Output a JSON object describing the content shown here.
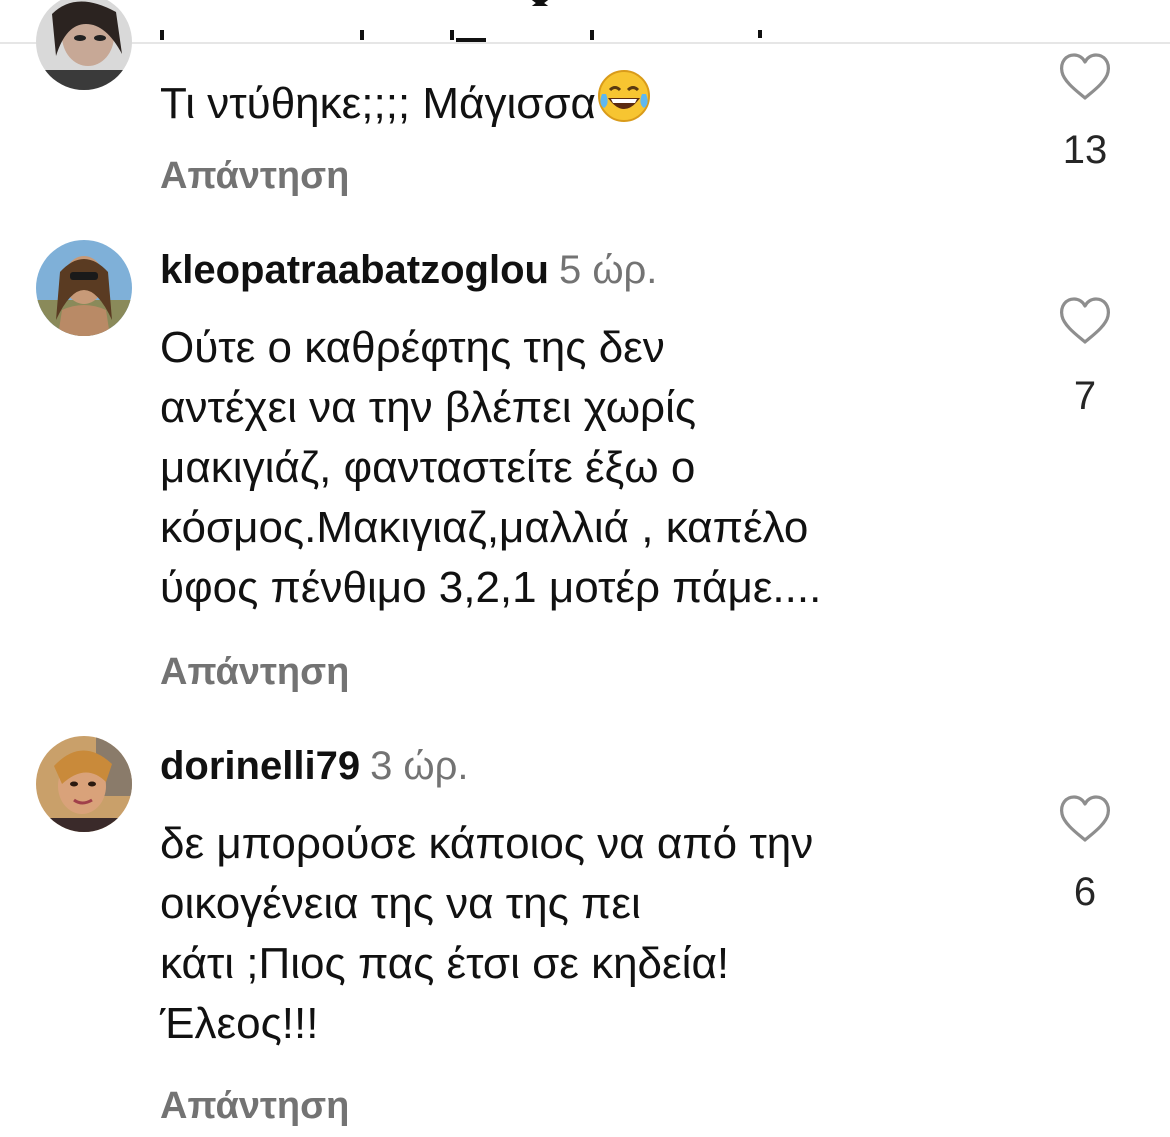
{
  "comments": [
    {
      "text": "Τι ντύθηκε;;;; Μάγισσα",
      "emoji": "laughing-tears-emoji",
      "reply_label": "Απάντηση",
      "likes": "13"
    },
    {
      "username": "kleopatraabatzoglou",
      "time": "5 ώρ.",
      "text": "Ούτε ο καθρέφτης της δεν\nαντέχει να την βλέπει χωρίς\nμακιγιάζ, φανταστείτε έξω ο\nκόσμος.Μακιγιαζ,μαλλιά , καπέλο\nύφος πένθιμο 3,2,1 μοτέρ πάμε....",
      "reply_label": "Απάντηση",
      "likes": "7"
    },
    {
      "username": "dorinelli79",
      "time": "3 ώρ.",
      "text": "δε μπορούσε κάποιος να από την\nοικογένεια της να της πει\nκάτι ;Πιος πας έτσι σε κηδεία!\nΈλεος!!!",
      "reply_label": "Απάντηση",
      "likes": "6"
    }
  ],
  "icons": {
    "like": "heart-outline-icon"
  },
  "colors": {
    "text": "#111111",
    "secondary": "#737373",
    "divider": "#e6e6e6"
  }
}
